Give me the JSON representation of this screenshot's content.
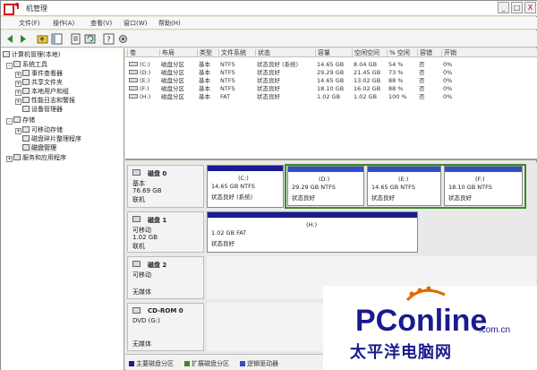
{
  "window": {
    "title": "机管理",
    "controls": [
      "_",
      "□",
      "X"
    ]
  },
  "menu": [
    "文件(F)",
    "操作(A)",
    "查看(V)",
    "窗口(W)",
    "帮助(H)"
  ],
  "tree": [
    {
      "label": "计算机管理(本地)",
      "level": 0,
      "exp": "",
      "selected": false
    },
    {
      "label": "系统工具",
      "level": 1,
      "exp": "-",
      "selected": false
    },
    {
      "label": "事件查看器",
      "level": 2,
      "exp": "+",
      "selected": false
    },
    {
      "label": "共享文件夹",
      "level": 2,
      "exp": "+",
      "selected": false
    },
    {
      "label": "本地用户和组",
      "level": 2,
      "exp": "+",
      "selected": false
    },
    {
      "label": "性能日志和警报",
      "level": 2,
      "exp": "+",
      "selected": false
    },
    {
      "label": "设备管理器",
      "level": 2,
      "exp": "",
      "selected": false
    },
    {
      "label": "存储",
      "level": 1,
      "exp": "-",
      "selected": false
    },
    {
      "label": "可移动存储",
      "level": 2,
      "exp": "+",
      "selected": false
    },
    {
      "label": "磁盘碎片整理程序",
      "level": 2,
      "exp": "",
      "selected": false
    },
    {
      "label": "磁盘管理",
      "level": 2,
      "exp": "",
      "selected": true
    },
    {
      "label": "服务和应用程序",
      "level": 1,
      "exp": "+",
      "selected": false
    }
  ],
  "volume_headers": [
    "卷",
    "布局",
    "类型",
    "文件系统",
    "状态",
    "容量",
    "空闲空间",
    "% 空闲",
    "容错",
    "开销"
  ],
  "volumes": [
    [
      "(C:)",
      "磁盘分区",
      "基本",
      "NTFS",
      "状态良好 (系统)",
      "14.65 GB",
      "8.04 GB",
      "54 %",
      "否",
      "0%"
    ],
    [
      "(D:)",
      "磁盘分区",
      "基本",
      "NTFS",
      "状态良好",
      "29.29 GB",
      "21.45 GB",
      "73 %",
      "否",
      "0%"
    ],
    [
      "(E:)",
      "磁盘分区",
      "基本",
      "NTFS",
      "状态良好",
      "14.65 GB",
      "13.02 GB",
      "88 %",
      "否",
      "0%"
    ],
    [
      "(F:)",
      "磁盘分区",
      "基本",
      "NTFS",
      "状态良好",
      "18.10 GB",
      "16.02 GB",
      "88 %",
      "否",
      "0%"
    ],
    [
      "(H:)",
      "磁盘分区",
      "基本",
      "FAT",
      "状态良好",
      "1.02 GB",
      "1.02 GB",
      "100 %",
      "否",
      "0%"
    ]
  ],
  "disks": [
    {
      "name": "磁盘 0",
      "kind": "基本",
      "size": "76.69 GB",
      "state": "联机",
      "parts": [
        {
          "letter": "(C:)",
          "info": "14.65 GB NTFS",
          "status": "状态良好 (系统)"
        },
        {
          "letter": "(D:)",
          "info": "29.29 GB NTFS",
          "status": "状态良好"
        },
        {
          "letter": "(E:)",
          "info": "14.65 GB NTFS",
          "status": "状态良好"
        },
        {
          "letter": "(F:)",
          "info": "18.10 GB NTFS",
          "status": "状态良好"
        }
      ]
    },
    {
      "name": "磁盘 1",
      "kind": "可移动",
      "size": "1.02 GB",
      "state": "联机",
      "parts": [
        {
          "letter": "(H:)",
          "info": "1.02 GB FAT",
          "status": "状态良好"
        }
      ]
    },
    {
      "name": "磁盘 2",
      "kind": "可移动",
      "size": "",
      "state": "无媒体",
      "parts": []
    },
    {
      "name": "CD-ROM 0",
      "kind": "DVD (G:)",
      "size": "",
      "state": "无媒体",
      "parts": []
    }
  ],
  "legend": [
    {
      "label": "主要磁盘分区",
      "color": "#1b1b90"
    },
    {
      "label": "扩展磁盘分区",
      "color": "#3a8a2a"
    },
    {
      "label": "逻辑驱动器",
      "color": "#3050c8"
    }
  ],
  "watermark": {
    "brand": "PConline",
    "domain": ".com.cn",
    "sub": "太平洋电脑网"
  }
}
